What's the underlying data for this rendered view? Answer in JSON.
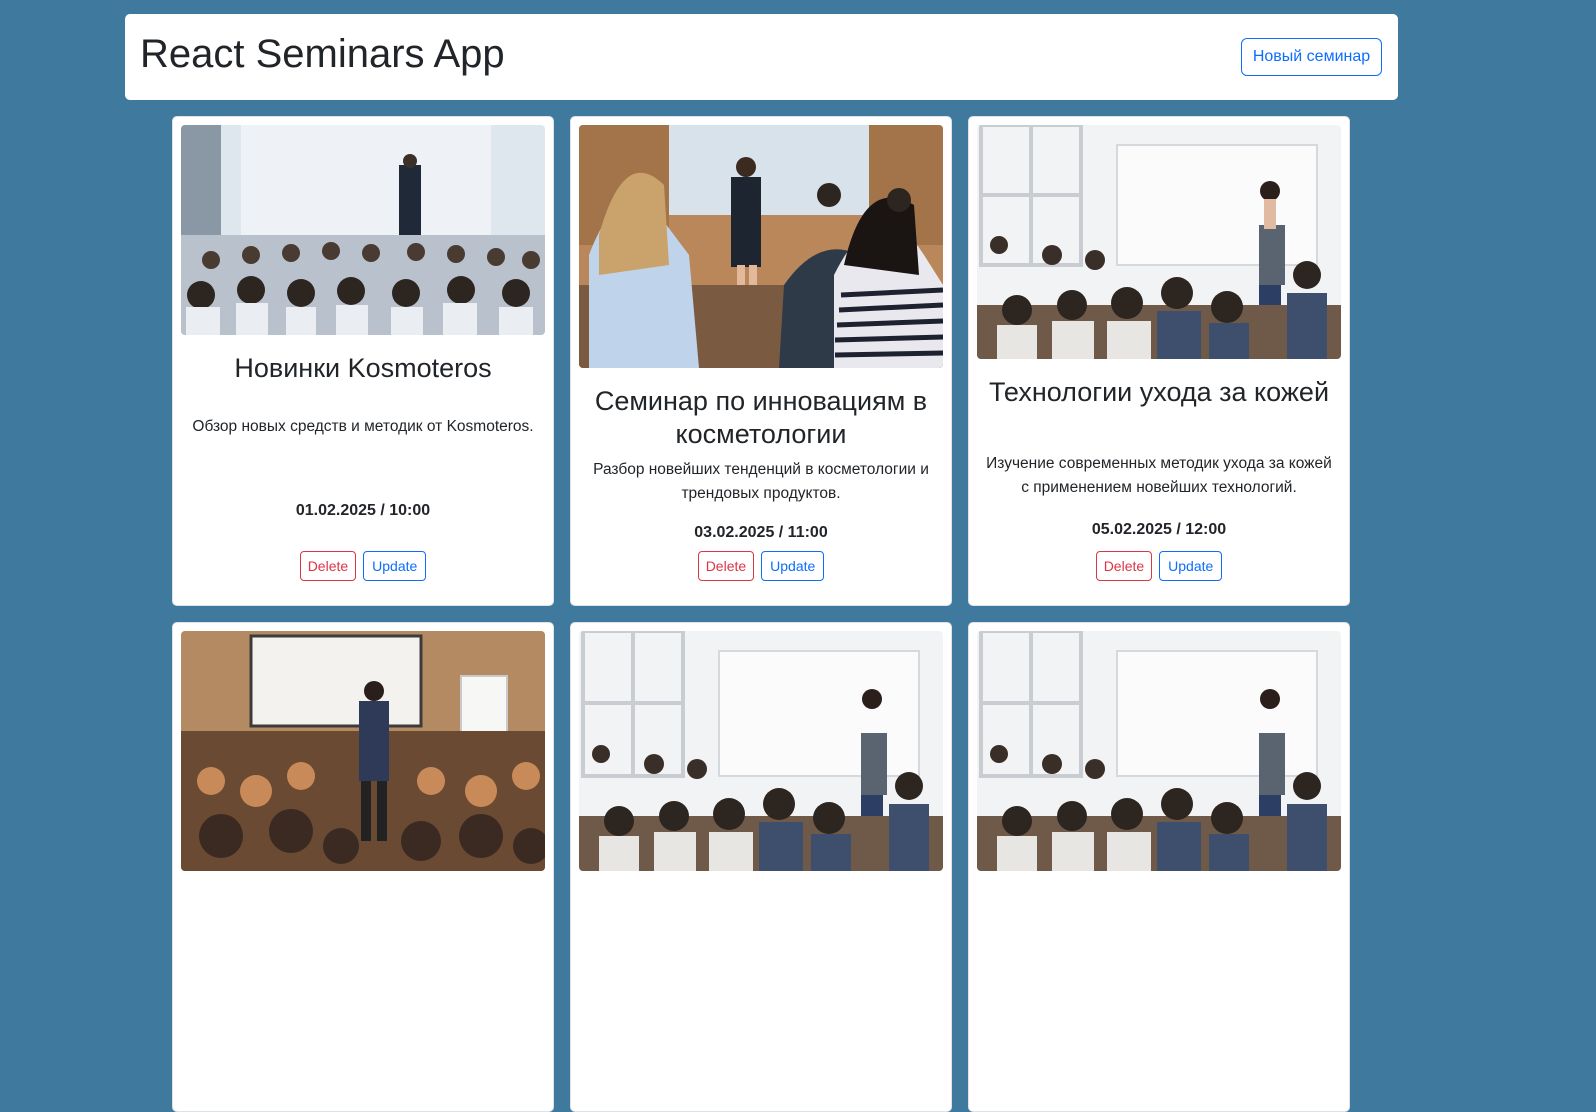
{
  "header": {
    "title": "React Seminars App",
    "new_button_label": "Новый семинар"
  },
  "cards": [
    {
      "title": "Новинки Kosmoteros",
      "description": "Обзор новых средств и методик от Kosmoteros.",
      "date": "01.02.2025 / 10:00",
      "delete_label": "Delete",
      "update_label": "Update"
    },
    {
      "title": "Семинар по инновациям в косметологии",
      "description": "Разбор новейших тенденций в косметологии и трендовых продуктов.",
      "date": "03.02.2025 / 11:00",
      "delete_label": "Delete",
      "update_label": "Update"
    },
    {
      "title": "Технологии ухода за кожей",
      "description": "Изучение современных методик ухода за кожей с применением новейших технологий.",
      "date": "05.02.2025 / 12:00",
      "delete_label": "Delete",
      "update_label": "Update"
    }
  ],
  "colors": {
    "page_background": "#3f7a9e",
    "primary": "#0d6efd",
    "danger": "#dc3545"
  }
}
